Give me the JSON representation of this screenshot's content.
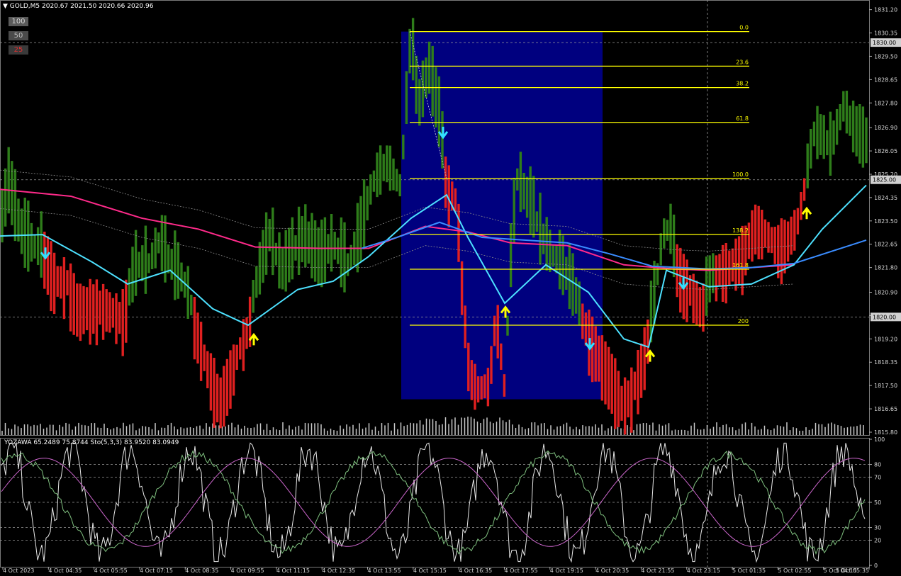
{
  "header": {
    "symbol_line": "GOLD,M5  2020.67 2021.50 2020.66 2020.96"
  },
  "level_buttons": [
    "100",
    "50",
    "25"
  ],
  "indicator_header": "YOZAWA 65.2489 75.8744  Sto(5,3,3) 83.9520 83.0949",
  "colors": {
    "background": "#000000",
    "bull": "#2e7d1a",
    "bear": "#e02020",
    "fib": "#ffff00",
    "fib_zone": "#00007f",
    "ma_pink": "#ff2a8a",
    "ma_cyan": "#4de1ff",
    "ma_blue": "#3a8cff",
    "grid": "#9a9a9a",
    "arrow_up": "#ffff00",
    "arrow_down": "#33e0ff",
    "volume": "#c8c8c8",
    "stoch_main": "#e8e8e8",
    "stoch_signal": "#cc66cc",
    "stoch_green": "#7fc07f"
  },
  "chart_data": [
    {
      "type": "candlestick",
      "title": "GOLD,M5",
      "ylim": [
        1815.8,
        1831.5
      ],
      "price_ticks": [
        "1831.20",
        "1830.35",
        "1829.50",
        "1828.65",
        "1827.80",
        "1826.90",
        "1826.05",
        "1825.20",
        "1824.35",
        "1823.50",
        "1822.65",
        "1821.80",
        "1820.90",
        "1820.05",
        "1819.20",
        "1818.35",
        "1817.50",
        "1816.65",
        "1815.80"
      ],
      "highlighted_prices": [
        "1830.00",
        "1825.00",
        "1820.00"
      ],
      "time_ticks": [
        "4 Oct 2023",
        "4 Oct 04:35",
        "4 Oct 05:55",
        "4 Oct 07:15",
        "4 Oct 08:35",
        "4 Oct 09:55",
        "4 Oct 11:15",
        "4 Oct 12:35",
        "4 Oct 13:55",
        "4 Oct 15:15",
        "4 Oct 16:35",
        "4 Oct 17:55",
        "4 Oct 19:15",
        "4 Oct 20:35",
        "4 Oct 21:55",
        "4 Oct 23:15",
        "5 Oct 01:35",
        "5 Oct 02:55",
        "5 Oct 04:15",
        "5 Oct 05:35"
      ],
      "fibonacci": {
        "from_price": 1830.4,
        "to_price": 1825.05,
        "levels": [
          {
            "label": "0.0",
            "price": 1830.4
          },
          {
            "label": "23.6",
            "price": 1829.14
          },
          {
            "label": "38.2",
            "price": 1828.36
          },
          {
            "label": "61.8",
            "price": 1827.09
          },
          {
            "label": "100.0",
            "price": 1825.05
          },
          {
            "label": "138.2",
            "price": 1823.01
          },
          {
            "label": "161.8",
            "price": 1821.74
          },
          {
            "label": "200",
            "price": 1819.7
          }
        ],
        "zone_price_range": [
          1817.0,
          1830.4
        ]
      },
      "price_path": [
        [
          0,
          1823.1
        ],
        [
          12,
          1824.8
        ],
        [
          30,
          1823.0
        ],
        [
          48,
          1822.5
        ],
        [
          65,
          1822.4
        ],
        [
          78,
          1821.5
        ],
        [
          95,
          1821.4
        ],
        [
          110,
          1820.5
        ],
        [
          130,
          1820.6
        ],
        [
          150,
          1820.5
        ],
        [
          172,
          1820.1
        ],
        [
          192,
          1821.8
        ],
        [
          210,
          1821.9
        ],
        [
          225,
          1822.7
        ],
        [
          240,
          1821.9
        ],
        [
          258,
          1821.3
        ],
        [
          272,
          1820.2
        ],
        [
          290,
          1818.5
        ],
        [
          310,
          1817.1
        ],
        [
          330,
          1818.4
        ],
        [
          348,
          1819.6
        ],
        [
          362,
          1821.2
        ],
        [
          380,
          1822.9
        ],
        [
          398,
          1821.6
        ],
        [
          412,
          1822.3
        ],
        [
          430,
          1822.8
        ],
        [
          450,
          1822.0
        ],
        [
          470,
          1822.6
        ],
        [
          490,
          1821.8
        ],
        [
          508,
          1822.9
        ],
        [
          525,
          1824.8
        ],
        [
          545,
          1825.5
        ],
        [
          565,
          1824.7
        ],
        [
          580,
          1830.3
        ],
        [
          590,
          1827.5
        ],
        [
          605,
          1829.0
        ],
        [
          620,
          1827.2
        ],
        [
          630,
          1824.9
        ],
        [
          645,
          1824.3
        ],
        [
          652,
          1821.2
        ],
        [
          662,
          1818.1
        ],
        [
          675,
          1817.5
        ],
        [
          690,
          1817.7
        ],
        [
          700,
          1820.3
        ],
        [
          712,
          1817.5
        ],
        [
          722,
          1822.8
        ],
        [
          730,
          1825.0
        ],
        [
          742,
          1824.3
        ],
        [
          752,
          1823.9
        ],
        [
          762,
          1823.0
        ],
        [
          775,
          1822.3
        ],
        [
          790,
          1821.9
        ],
        [
          805,
          1821.2
        ],
        [
          818,
          1820.3
        ],
        [
          832,
          1819.4
        ],
        [
          848,
          1818.6
        ],
        [
          862,
          1818.0
        ],
        [
          878,
          1817.0
        ],
        [
          892,
          1817.4
        ],
        [
          905,
          1818.4
        ],
        [
          915,
          1819.5
        ],
        [
          925,
          1821.0
        ],
        [
          935,
          1822.9
        ],
        [
          945,
          1823.2
        ],
        [
          952,
          1822.2
        ],
        [
          962,
          1821.6
        ],
        [
          975,
          1821.1
        ],
        [
          990,
          1820.5
        ],
        [
          1002,
          1821.3
        ],
        [
          1015,
          1821.9
        ],
        [
          1030,
          1822.0
        ],
        [
          1048,
          1822.5
        ],
        [
          1065,
          1823.5
        ],
        [
          1080,
          1823.2
        ],
        [
          1098,
          1822.7
        ],
        [
          1112,
          1823.0
        ],
        [
          1125,
          1823.6
        ],
        [
          1138,
          1825.2
        ],
        [
          1148,
          1826.6
        ],
        [
          1160,
          1826.5
        ],
        [
          1172,
          1826.1
        ],
        [
          1190,
          1827.6
        ],
        [
          1205,
          1826.7
        ],
        [
          1220,
          1826.3
        ]
      ],
      "bear_ranges_x": [
        [
          60,
          180
        ],
        [
          270,
          355
        ],
        [
          625,
          715
        ],
        [
          820,
          915
        ],
        [
          955,
          995
        ],
        [
          1010,
          1135
        ]
      ],
      "moving_averages": [
        {
          "color": "pink",
          "path": [
            [
              0,
              1824.65
            ],
            [
              100,
              1824.4
            ],
            [
              200,
              1823.6
            ],
            [
              280,
              1823.2
            ],
            [
              360,
              1822.55
            ],
            [
              450,
              1822.5
            ],
            [
              520,
              1822.5
            ],
            [
              600,
              1823.3
            ],
            [
              660,
              1823.1
            ],
            [
              720,
              1822.7
            ],
            [
              800,
              1822.6
            ],
            [
              880,
              1821.9
            ],
            [
              950,
              1821.75
            ],
            [
              1000,
              1821.7
            ],
            [
              1060,
              1821.8
            ],
            [
              1120,
              1821.9
            ]
          ]
        },
        {
          "color": "cyan",
          "path": [
            [
              0,
              1822.95
            ],
            [
              60,
              1823.0
            ],
            [
              130,
              1822.0
            ],
            [
              180,
              1821.2
            ],
            [
              240,
              1821.7
            ],
            [
              300,
              1820.3
            ],
            [
              350,
              1819.7
            ],
            [
              420,
              1821.0
            ],
            [
              470,
              1821.3
            ],
            [
              520,
              1822.2
            ],
            [
              580,
              1823.6
            ],
            [
              630,
              1824.45
            ],
            [
              660,
              1822.9
            ],
            [
              712,
              1820.5
            ],
            [
              770,
              1821.9
            ],
            [
              830,
              1820.9
            ],
            [
              880,
              1819.2
            ],
            [
              915,
              1818.9
            ],
            [
              940,
              1821.7
            ],
            [
              1000,
              1821.1
            ],
            [
              1060,
              1821.2
            ],
            [
              1120,
              1821.9
            ],
            [
              1160,
              1823.2
            ],
            [
              1222,
              1824.8
            ]
          ]
        },
        {
          "color": "blue",
          "path": [
            [
              510,
              1822.5
            ],
            [
              560,
              1822.9
            ],
            [
              620,
              1823.45
            ],
            [
              680,
              1822.9
            ],
            [
              740,
              1822.8
            ],
            [
              800,
              1822.7
            ],
            [
              860,
              1822.3
            ],
            [
              920,
              1821.85
            ],
            [
              1000,
              1821.75
            ],
            [
              1060,
              1821.8
            ],
            [
              1120,
              1821.95
            ],
            [
              1222,
              1822.8
            ]
          ]
        }
      ],
      "signal_arrows": [
        {
          "direction": "down",
          "x": 64,
          "price": 1822.3
        },
        {
          "direction": "up",
          "x": 358,
          "price": 1819.2
        },
        {
          "direction": "down",
          "x": 625,
          "price": 1826.7
        },
        {
          "direction": "up",
          "x": 713,
          "price": 1820.2
        },
        {
          "direction": "down",
          "x": 832,
          "price": 1819.0
        },
        {
          "direction": "up",
          "x": 917,
          "price": 1818.6
        },
        {
          "direction": "down",
          "x": 964,
          "price": 1821.2
        },
        {
          "direction": "up",
          "x": 1138,
          "price": 1823.8
        }
      ]
    },
    {
      "type": "line",
      "title": "Sto(5,3,3)",
      "ylim": [
        0,
        100
      ],
      "levels": [
        "100",
        "80",
        "70",
        "50",
        "30",
        "20",
        "0"
      ],
      "series": [
        {
          "name": "YOZAWA",
          "values": [
            65.2,
            75.9
          ]
        },
        {
          "name": "Sto(5,3,3)",
          "values": [
            83.95,
            83.09
          ]
        }
      ]
    }
  ]
}
